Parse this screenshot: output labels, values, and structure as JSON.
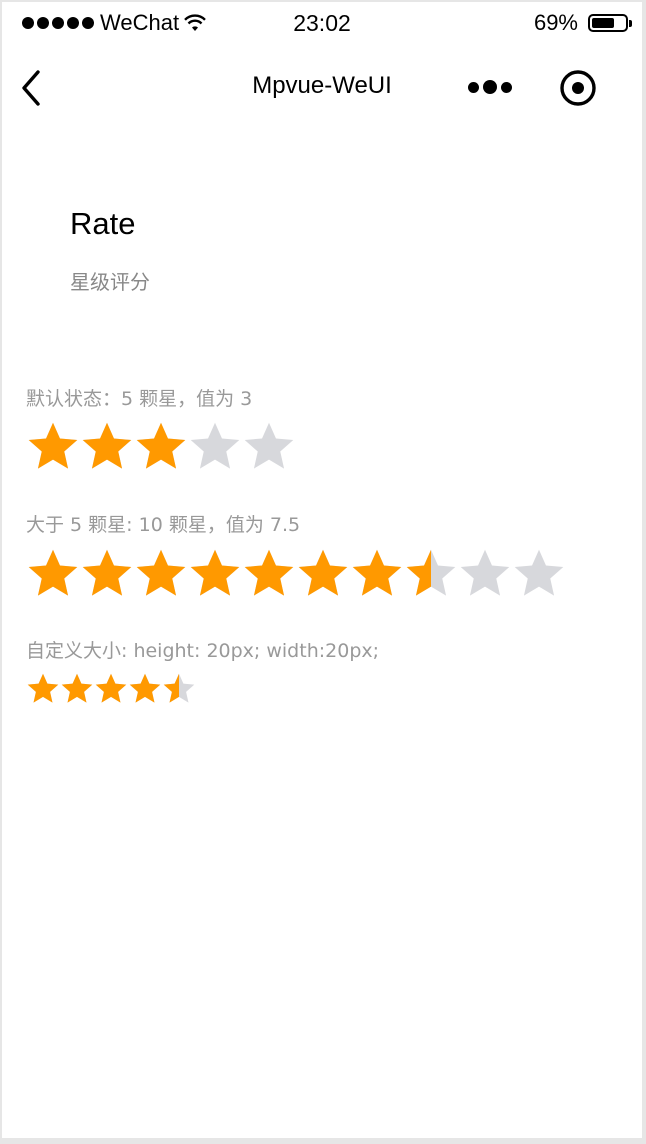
{
  "statusbar": {
    "carrier": "WeChat",
    "time": "23:02",
    "battery_text": "69%",
    "battery_level": 0.69
  },
  "navbar": {
    "title": "Mpvue-WeUI",
    "back_icon": "chevron-left-icon",
    "more_icon": "more-dots-icon",
    "close_icon": "target-circle-icon"
  },
  "page": {
    "title": "Rate",
    "desc": "星级评分"
  },
  "demos": [
    {
      "label": "默认状态：5 颗星，值为 3",
      "max": 5,
      "value": 3
    },
    {
      "label": "大于 5 颗星: 10 颗星，值为 7.5",
      "max": 10,
      "value": 7.5
    },
    {
      "label": "自定义大小: height: 20px; width:20px;",
      "max": 5,
      "value": 4.5
    }
  ],
  "colors": {
    "star_active": "#FF9900",
    "star_inactive": "#D7D8DC",
    "label": "#999999",
    "desc": "#888888"
  }
}
